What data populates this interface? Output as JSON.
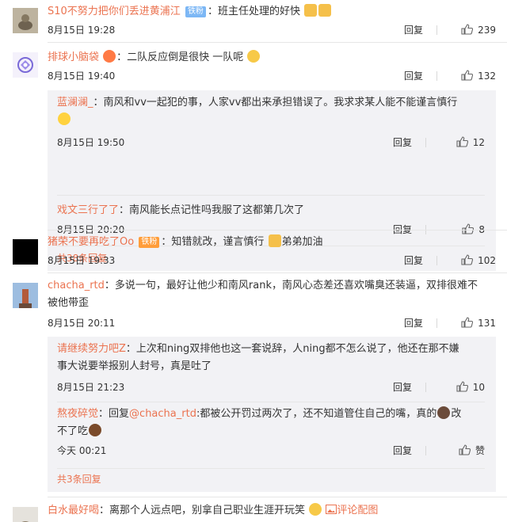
{
  "ui": {
    "reply_label": "回复",
    "more_color": "#eb7350",
    "name_color": "#eb7350"
  },
  "comments": [
    {
      "user": "S10不努力把你们丢进黄浦江",
      "badge": "铁粉",
      "text": "班主任处理的好快",
      "time": "8月15日 19:28",
      "likes": "239"
    },
    {
      "user": "排球小脑袋",
      "text": "二队反应倒是很快 一队呢",
      "time": "8月15日 19:40",
      "likes": "132",
      "replies": [
        {
          "user": "蓝澜澜_",
          "text": "南风和vv一起犯的事，人家vv都出来承担错误了。我求求某人能不能谨言慎行",
          "time": "8月15日 19:50",
          "likes": "12"
        },
        {
          "user": "戏文三行了了",
          "text": "南风能长点记性吗我服了这都第几次了",
          "time": "8月15日 20:20",
          "likes": "8"
        }
      ],
      "more": "共38条回复"
    },
    {
      "user": "猪荣不要再吃了Oo",
      "badge": "铁粉",
      "text": "知错就改，谨言慎行",
      "text2": "弟弟加油",
      "time": "8月15日 19:33",
      "likes": "102"
    },
    {
      "user": "chacha_rtd",
      "text": "多说一句，最好让他少和南风rank，南风心态差还喜欢嘴臭还装逼，双排很难不",
      "text_line2": "被他带歪",
      "time": "8月15日 20:11",
      "likes": "131",
      "replies": [
        {
          "user": "请继续努力吧Z",
          "text": "上次和ning双排他也这一套说辞，人ning都不怎么说了，他还在那不嫌",
          "text_line2": "事大说要举报别人封号，真是吐了",
          "time": "8月15日 21:23",
          "likes": "10"
        },
        {
          "user": "熬夜碎觉",
          "text_prefix": "回复",
          "mention": "@chacha_rtd",
          "text": ":都被公开罚过两次了，还不知道管住自己的嘴，真的",
          "text_after": "改",
          "text_line2": "不了吃",
          "time": "今天 00:21",
          "likes": "赞"
        }
      ],
      "more": "共3条回复"
    },
    {
      "user": "白水最好喝",
      "text": "离那个人远点吧，别拿自己职业生涯开玩笑",
      "report": "评论配图"
    }
  ]
}
